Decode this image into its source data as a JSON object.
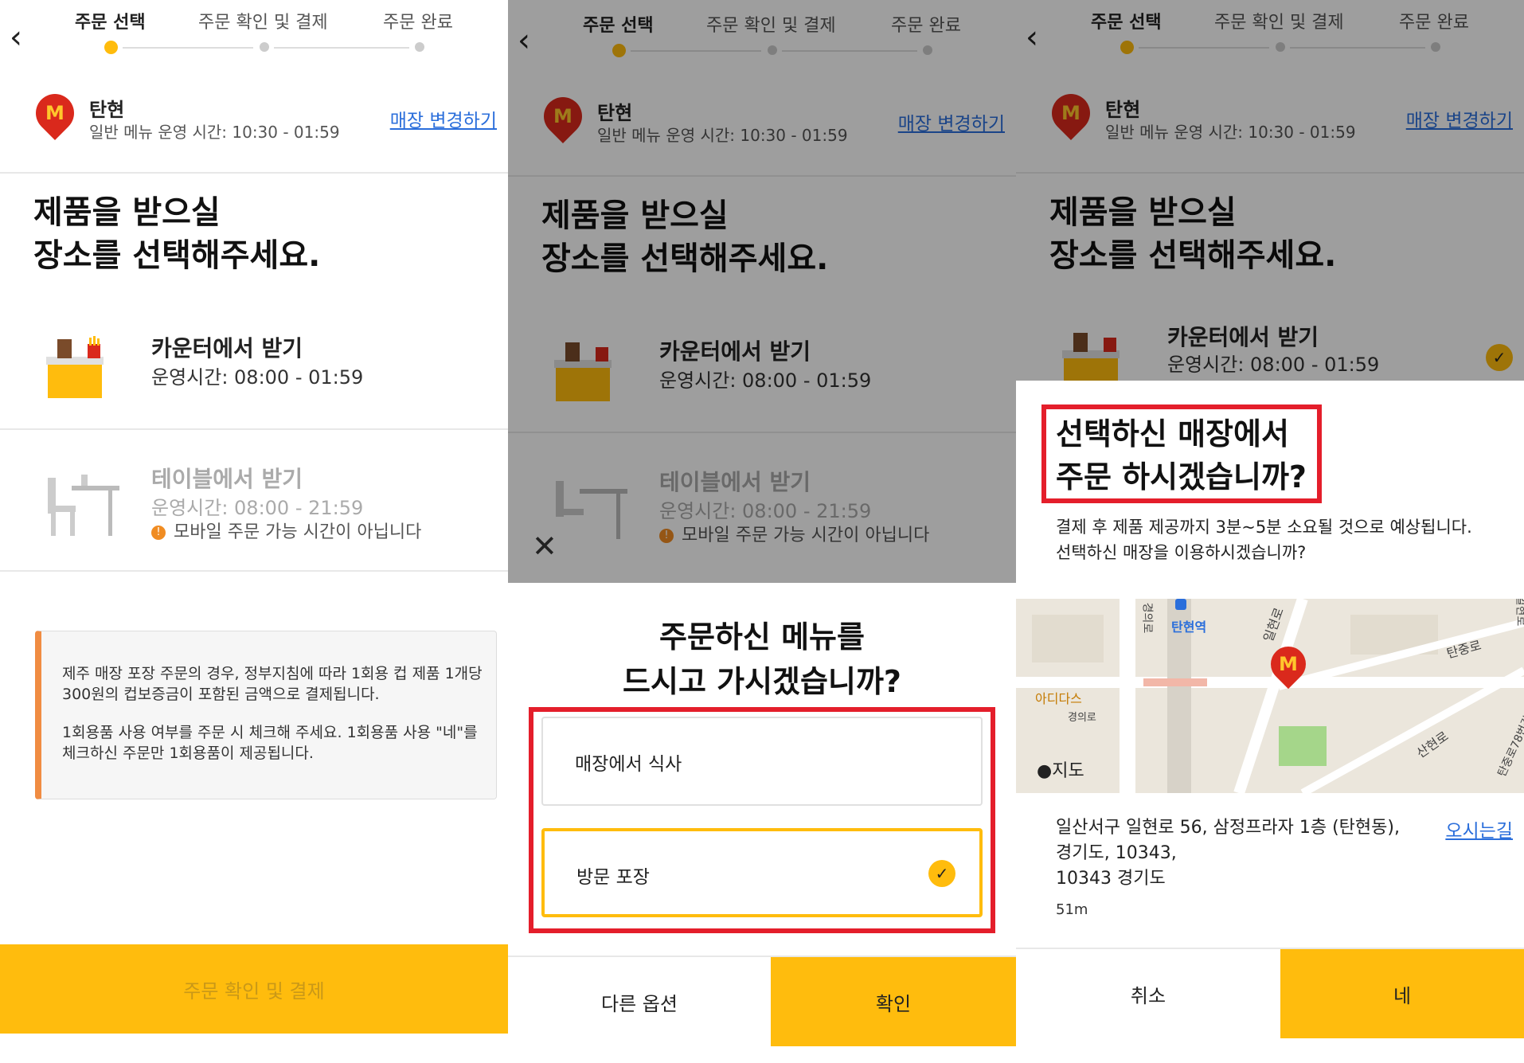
{
  "steps": [
    "주문 선택",
    "주문 확인 및 결제",
    "주문 완료"
  ],
  "store": {
    "logo": "M",
    "name": "탄현",
    "hours": "일반 메뉴 운영 시간: 10:30 - 01:59",
    "change_link": "매장 변경하기"
  },
  "question": [
    "제품을 받으실",
    "장소를 선택해주세요."
  ],
  "options": [
    {
      "title": "카운터에서 받기",
      "hours": "운영시간: 08:00 - 01:59"
    },
    {
      "title": "테이블에서 받기",
      "hours": "운영시간: 08:00 - 21:59",
      "warning": "모바일 주문 가능 시간이 아닙니다"
    }
  ],
  "notice": [
    "제주 매장 포장 주문의 경우, 정부지침에 따라 1회용 컵 제품 1개당 300원의 컵보증금이 포함된 금액으로 결제됩니다.",
    "1회용품 사용 여부를 주문 시 체크해 주세요. 1회용품 사용 \"네\"를 체크하신 주문만 1회용품이 제공됩니다."
  ],
  "cta": "주문 확인 및 결제",
  "dine_sheet": {
    "question": [
      "주문하신 메뉴를",
      "드시고 가시겠습니까?"
    ],
    "choices": [
      {
        "label": "매장에서 식사",
        "selected": false
      },
      {
        "label": "방문 포장",
        "selected": true
      }
    ],
    "other_button": "다른 옵션",
    "confirm_button": "확인"
  },
  "confirm_dialog": {
    "question": [
      "선택하신 매장에서",
      "주문 하시겠습니까?"
    ],
    "message": [
      "결제 후 제품 제공까지 3분~5분 소요될 것으로 예상됩니다.",
      "선택하신 매장을 이용하시겠습니까?"
    ],
    "map_labels": {
      "station": "탄현역",
      "shop": "아디다스",
      "road1": "일현로",
      "road2": "경의로",
      "road3": "탄중로",
      "road4": "산현로",
      "road5": "탄중로78번길",
      "road6": "경의로",
      "road7": "일현로",
      "attribution": "지도"
    },
    "address": [
      "일산서구 일현로 56, 삼정프라자 1층 (탄현동),",
      "경기도, 10343,",
      "10343 경기도"
    ],
    "distance": "51m",
    "directions_link": "오시는길",
    "cancel_button": "취소",
    "yes_button": "네"
  },
  "colors": {
    "brand_yellow": "#ffbc0d",
    "brand_red": "#da291c",
    "highlight_red": "#e41e2b",
    "link_blue": "#2a6edb"
  }
}
